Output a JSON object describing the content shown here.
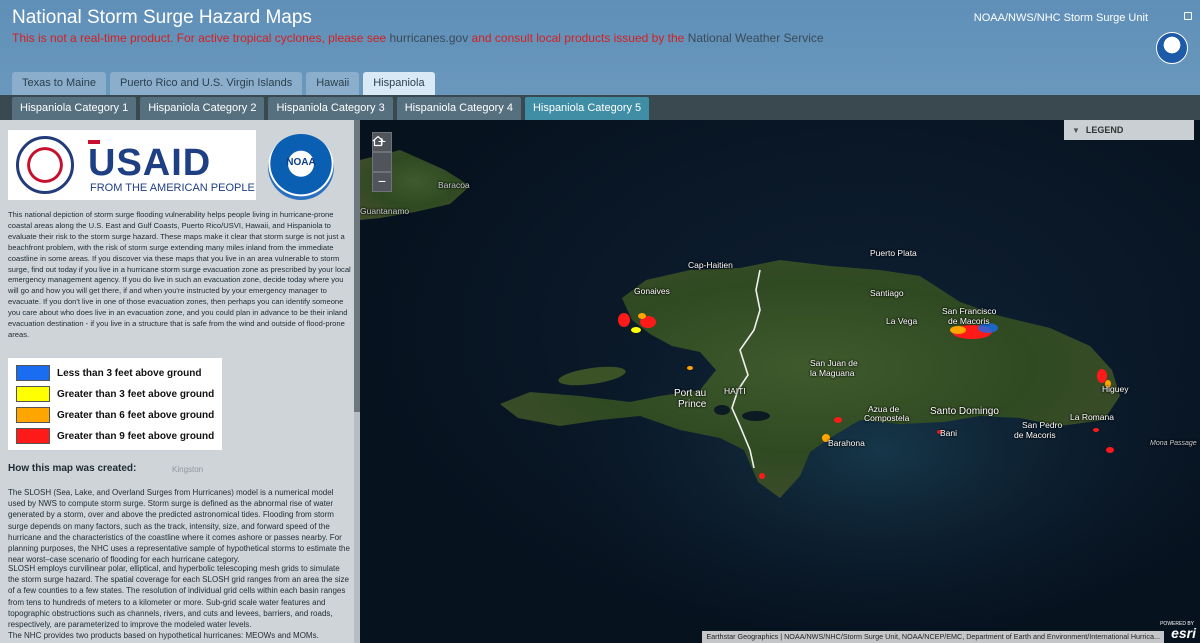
{
  "header": {
    "title": "National Storm Surge Hazard Maps",
    "disclaimer_part1": "This is not a real-time product. For active tropical cyclones, please see ",
    "disclaimer_link1": "hurricanes.gov",
    "disclaimer_part2": " and consult local products issued by the ",
    "disclaimer_link2": "National Weather Service",
    "org_name": "NOAA/NWS/NHC Storm Surge Unit"
  },
  "tabs_top": [
    {
      "label": "Texas to Maine",
      "active": false
    },
    {
      "label": "Puerto Rico and U.S. Virgin Islands",
      "active": false
    },
    {
      "label": "Hawaii",
      "active": false
    },
    {
      "label": "Hispaniola",
      "active": true
    }
  ],
  "tabs_sub": [
    {
      "label": "Hispaniola Category 1",
      "active": false
    },
    {
      "label": "Hispaniola Category 2",
      "active": false
    },
    {
      "label": "Hispaniola Category 3",
      "active": false
    },
    {
      "label": "Hispaniola Category 4",
      "active": false
    },
    {
      "label": "Hispaniola Category 5",
      "active": true
    }
  ],
  "panel": {
    "usaid_word": "USAID",
    "usaid_slogan": "FROM THE AMERICAN PEOPLE",
    "noaa_text": "NOAA",
    "intro": "This national depiction of storm surge flooding vulnerability helps people living in hurricane-prone coastal areas along the U.S. East and Gulf Coasts, Puerto Rico/USVI, Hawaii, and Hispaniola to evaluate their risk to the storm surge hazard. These maps make it clear that storm surge is not just a beachfront problem, with the risk of storm surge extending many miles inland from the immediate coastline in some areas. If you discover via these maps that you live in an area vulnerable to storm surge, find out today if you live in a hurricane storm surge evacuation zone as prescribed by your local emergency management agency. If you do live in such an evacuation zone, decide today where you will go and how you will get there, if and when you're instructed by your emergency manager to evacuate. If you don't live in one of those evacuation zones, then perhaps you can identify someone you care about who does live in an evacuation zone, and you could plan in advance to be their inland evacuation destination - if you live in a structure that is safe from the wind and outside of flood-prone areas.",
    "legend": [
      {
        "label": "Less than 3 feet above ground",
        "color": "#1a6cf0"
      },
      {
        "label": "Greater than 3 feet above ground",
        "color": "#ffff00"
      },
      {
        "label": "Greater than 6 feet above ground",
        "color": "#ffa500"
      },
      {
        "label": "Greater than 9 feet above ground",
        "color": "#ff1a1a"
      }
    ],
    "howto_title": "How this map was created:",
    "para1": "The SLOSH (Sea, Lake, and Overland Surges from Hurricanes) model is a numerical model used by NWS to compute storm surge. Storm surge is defined as the abnormal rise of water generated by a storm, over and above the predicted astronomical tides. Flooding from storm surge depends on many factors, such as the track, intensity, size, and forward speed of the hurricane and the characteristics of the coastline where it comes ashore or passes nearby. For planning purposes, the NHC uses a representative sample of hypothetical storms to estimate the near worst–case scenario of flooding for each hurricane category.",
    "para2": "SLOSH employs curvilinear polar, elliptical, and hyperbolic telescoping mesh grids to simulate the storm surge hazard. The spatial coverage for each SLOSH grid ranges from an area the size of a few counties to a few states. The resolution of individual grid cells within each basin ranges from tens to hundreds of meters to a kilometer or more. Sub-grid scale water features and topographic obstructions such as channels, rivers, and cuts and levees, barriers, and roads, respectively, are parameterized to improve the modeled water levels.",
    "para3": "The NHC provides two products based on hypothetical hurricanes: MEOWs and MOMs.",
    "bg_label": "Kingston"
  },
  "map": {
    "legend_toggle": "LEGEND",
    "zoom_in": "+",
    "home_icon": "home-icon",
    "zoom_out": "−",
    "attribution": "Earthstar Geographics | NOAA/NWS/NHC/Storm Surge Unit, NOAA/NCEP/EMC, Department of Earth and Environment/International Hurrica...",
    "esri_powered": "POWERED BY",
    "esri": "esri",
    "labels": {
      "baracoa": "Baracoa",
      "guantanamo": "Guantanamo",
      "cap_haitien": "Cap-Haitien",
      "puerto_plata": "Puerto Plata",
      "gonaives": "Gonaives",
      "santiago": "Santiago",
      "san_francisco": "San Francisco",
      "de_macoris": "de Macoris",
      "la_vega": "La Vega",
      "san_juan": "San Juan de",
      "la_maguana": "la Maguana",
      "haiti": "HAITI",
      "port_au": "Port au",
      "prince": "Prince",
      "azua": "Azua de",
      "compostela": "Compostela",
      "higuey": "Higuey",
      "santo_domingo": "Santo Domingo",
      "barahona": "Barahona",
      "bani": "Bani",
      "la_romana": "La Romana",
      "san_pedro": "San Pedro",
      "de_macoris2": "de Macoris",
      "mona_passage": "Mona Passage"
    }
  }
}
